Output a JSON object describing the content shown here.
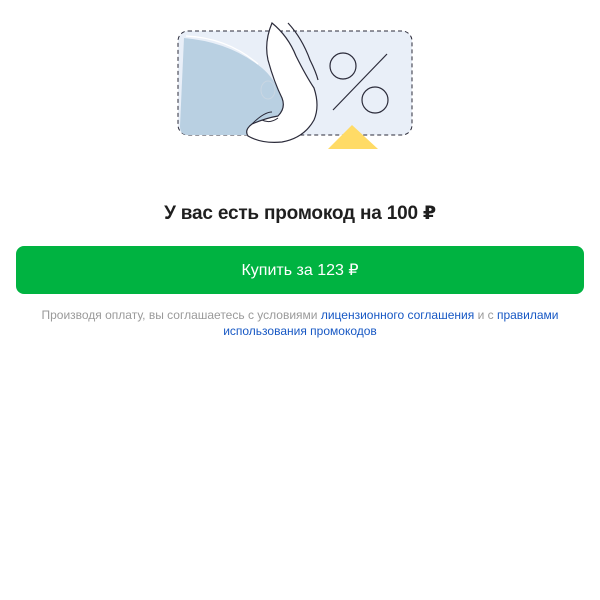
{
  "promo": {
    "title": "У вас есть промокод на 100 ₽",
    "buy_label": "Купить за 123 ₽"
  },
  "legal": {
    "text_before": "Производя оплату, вы соглашаетесь с условиями ",
    "license_link": "лицензионного соглашения",
    "text_middle": " и с ",
    "rules_link": "правилами использования промокодов"
  },
  "colors": {
    "accent_button": "#00b341",
    "link": "#1758c4",
    "muted_text": "#9a9a9a",
    "coupon_fill": "#e9eff8",
    "yellow": "#ffdb66"
  },
  "icons": {
    "illustration": "hand-peeling-discount-coupon-illustration"
  }
}
